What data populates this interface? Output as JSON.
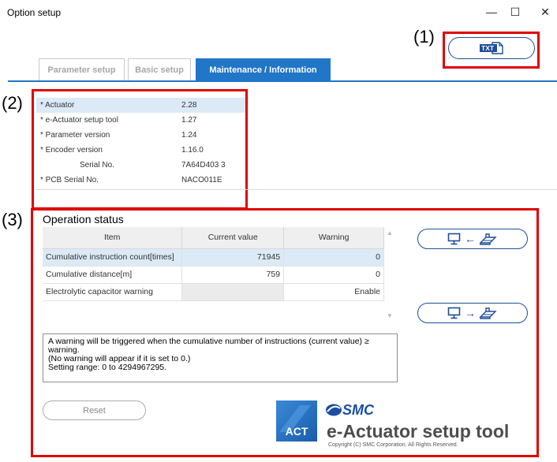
{
  "window": {
    "title": "Option setup",
    "minimize": "—",
    "maximize": "☐",
    "close": "✕"
  },
  "toolbar": {
    "export_txt_label": "TXT"
  },
  "callouts": {
    "c1": "(1)",
    "c2": "(2)",
    "c3": "(3)"
  },
  "tabs": [
    {
      "label": "Parameter setup",
      "active": false
    },
    {
      "label": "Basic setup",
      "active": false
    },
    {
      "label": "Maintenance / Information",
      "active": true
    }
  ],
  "info": [
    {
      "label": "* Actuator",
      "value": "2.28"
    },
    {
      "label": "* e-Actuator setup tool",
      "value": "1.27"
    },
    {
      "label": "* Parameter version",
      "value": "1.24"
    },
    {
      "label": "* Encoder version",
      "value": "1.16.0"
    },
    {
      "label": "Serial No.",
      "value": "7A64D403 3"
    },
    {
      "label": "* PCB Serial No.",
      "value": "NACO011E"
    }
  ],
  "operation": {
    "title": "Operation status",
    "columns": [
      "Item",
      "Current value",
      "Warning"
    ],
    "rows": [
      {
        "item": "Cumulative instruction count[times]",
        "current": "71945",
        "warning": "0"
      },
      {
        "item": "Cumulative distance[m]",
        "current": "759",
        "warning": "0"
      },
      {
        "item": "Electrolytic capacitor warning",
        "current": "",
        "warning": "Enable"
      }
    ],
    "read_arrow": "←",
    "write_arrow": "→",
    "message": [
      "A warning will be triggered when the cumulative number of instructions (current value) ≥",
      "warning.",
      "(No warning will appear if it is set to 0.)",
      "Setting range: 0 to 4294967295."
    ],
    "reset_label": "Reset"
  },
  "branding": {
    "act_text": "ACT",
    "smc_text": "SMC",
    "product_title": "e-Actuator setup tool",
    "copyright": "Copyright (C) SMC Corporation. All Rights Reserved."
  },
  "colors": {
    "accent": "#2176c8",
    "annotation_red": "#e00000",
    "button_border": "#1f4e97",
    "selected_row": "#dceaf7"
  }
}
